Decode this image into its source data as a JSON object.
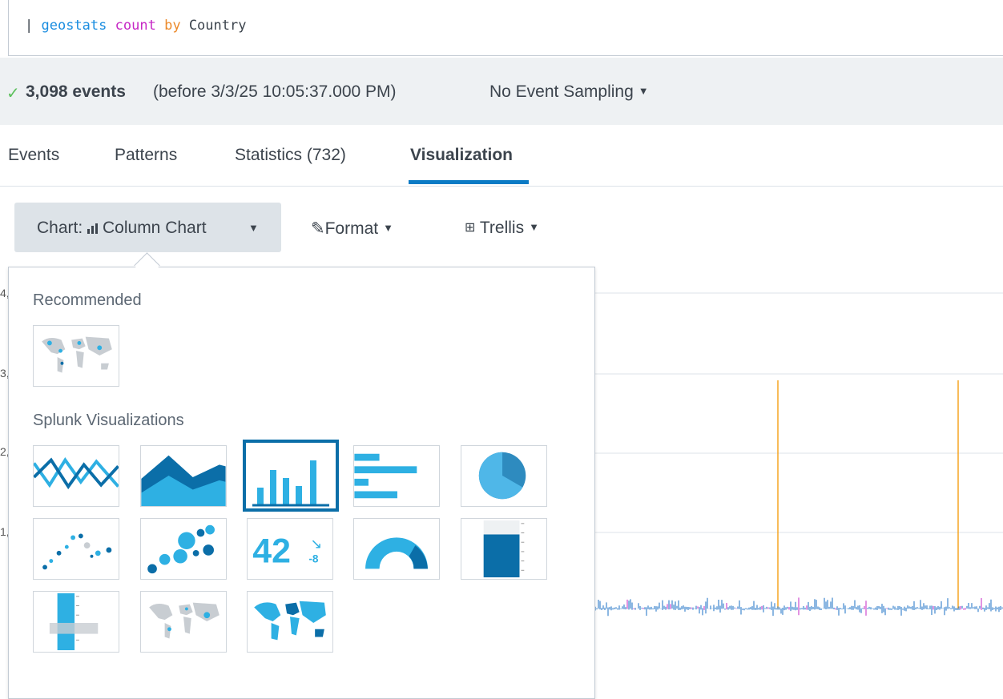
{
  "search": {
    "pipe": "|",
    "command": "geostats",
    "function": "count",
    "keyword": "by",
    "field": "Country"
  },
  "status": {
    "check_icon": "checkmark-icon",
    "event_count": "3,098 events",
    "before_text": "(before 3/3/25 10:05:37.000 PM)",
    "sampling_label": "No Event Sampling"
  },
  "tabs": [
    {
      "label": "Events"
    },
    {
      "label": "Patterns"
    },
    {
      "label": "Statistics (732)"
    },
    {
      "label": "Visualization",
      "active": true
    }
  ],
  "toolbar": {
    "chart_prefix": "Chart:",
    "chart_value": "Column Chart",
    "format_label": "Format",
    "trellis_label": "Trellis"
  },
  "chart_partial": {
    "axis_fragments": [
      "4,",
      "3,",
      "2,",
      "1,"
    ],
    "spike_color": "#f6a623",
    "line_color": "#1a6fc4"
  },
  "panel": {
    "recommended_heading": "Recommended",
    "splunk_heading": "Splunk Visualizations",
    "recommended": [
      {
        "name": "cluster-map-icon"
      }
    ],
    "visualizations": [
      {
        "name": "line-chart-icon"
      },
      {
        "name": "area-chart-icon"
      },
      {
        "name": "column-chart-icon",
        "selected": true
      },
      {
        "name": "bar-chart-icon"
      },
      {
        "name": "pie-chart-icon"
      },
      {
        "name": "scatter-chart-icon"
      },
      {
        "name": "bubble-chart-icon"
      },
      {
        "name": "single-value-icon",
        "value": "42",
        "delta": "-8"
      },
      {
        "name": "radial-gauge-icon"
      },
      {
        "name": "filler-gauge-icon"
      },
      {
        "name": "marker-gauge-icon"
      },
      {
        "name": "cluster-map-icon"
      },
      {
        "name": "choropleth-map-icon"
      }
    ]
  },
  "colors": {
    "accent": "#0b6ea8",
    "viz_light": "#2eb0e3",
    "viz_dark": "#0b6ea8"
  }
}
